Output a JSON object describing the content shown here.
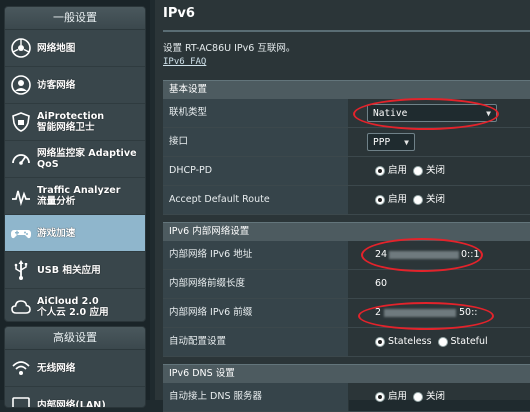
{
  "sidebar": {
    "general_header": "一般设置",
    "items": [
      {
        "label": "网络地图",
        "icon": "network-map-icon"
      },
      {
        "label": "访客网络",
        "icon": "guest-network-icon"
      },
      {
        "label": "AiProtection\n智能网络卫士",
        "icon": "aiprotection-icon"
      },
      {
        "label": "网络监控家 Adaptive\nQoS",
        "icon": "adaptive-qos-icon"
      },
      {
        "label": "Traffic Analyzer\n流量分析",
        "icon": "traffic-analyzer-icon"
      },
      {
        "label": "游戏加速",
        "icon": "game-boost-icon",
        "active": true
      },
      {
        "label": "USB 相关应用",
        "icon": "usb-icon"
      },
      {
        "label": "AiCloud 2.0\n个人云 2.0 应用",
        "icon": "aicloud-icon"
      }
    ],
    "advanced_header": "高级设置",
    "advanced_items": [
      {
        "label": "无线网络",
        "icon": "wireless-icon"
      },
      {
        "label": "内部网络(LAN)",
        "icon": "lan-icon"
      }
    ]
  },
  "main": {
    "title": "IPv6",
    "description": "设置 RT-AC86U IPv6 互联网。",
    "faq_link": "IPv6 FAQ",
    "basic": {
      "header": "基本设置",
      "connection_type_label": "联机类型",
      "connection_type_value": "Native",
      "interface_label": "接口",
      "interface_value": "PPP",
      "dhcp_pd_label": "DHCP-PD",
      "enable_label": "启用",
      "disable_label": "关闭",
      "accept_route_label": "Accept Default Route"
    },
    "lan": {
      "header": "IPv6 内部网络设置",
      "lan_address_label": "内部网络 IPv6 地址",
      "lan_address_prefix": "24",
      "lan_address_suffix": "0::1",
      "prefix_length_label": "内部网络前缀长度",
      "prefix_length_value": "60",
      "lan_prefix_label": "内部网络 IPv6 前缀",
      "lan_prefix_prefix": "2",
      "lan_prefix_suffix": "50::",
      "auto_config_label": "自动配置设置",
      "stateless_label": "Stateless",
      "stateful_label": "Stateful"
    },
    "dns": {
      "header": "IPv6 DNS 设置",
      "auto_dns_label": "自动接上 DNS 服务器",
      "enable_label": "启用",
      "disable_label": "关闭"
    }
  },
  "colors": {
    "annotation_red": "#e3232b",
    "active_item": "#8fb6cc",
    "section_header": "#4d5b60"
  }
}
